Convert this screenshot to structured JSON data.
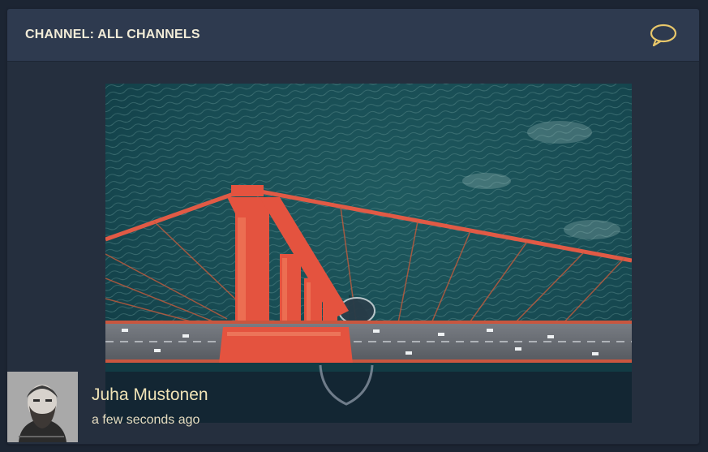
{
  "header": {
    "title": "CHANNEL: ALL CHANNELS",
    "chat_icon": "speech-bubble-icon"
  },
  "post": {
    "image_alt": "Aerial view of a red suspension bridge tower over water",
    "author": "Juha Mustonen",
    "time": "a few seconds ago",
    "avatar_icon": "user-avatar"
  },
  "colors": {
    "background": "#1c2533",
    "panel": "#252f3e",
    "header": "#2e3a4f",
    "title_text": "#f2ecd8",
    "accent_gold": "#e8c76a",
    "author_text": "#f0e3b6"
  }
}
